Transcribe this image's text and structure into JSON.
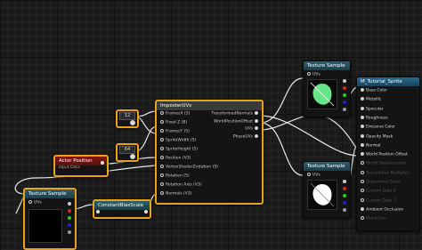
{
  "texture_sample_top": {
    "title": "Texture Sample",
    "uvs": "UVs"
  },
  "texture_sample_mid": {
    "title": "Texture Sample",
    "uvs": "UVs"
  },
  "texture_sample_left": {
    "title": "Texture Sample",
    "uvs": "UVs"
  },
  "material": {
    "title": "M_Tutorial_Sprite",
    "pins": [
      {
        "label": "Base Color",
        "enabled": true
      },
      {
        "label": "Metallic",
        "enabled": true
      },
      {
        "label": "Specular",
        "enabled": true
      },
      {
        "label": "Roughness",
        "enabled": true
      },
      {
        "label": "Emissive Color",
        "enabled": true
      },
      {
        "label": "Opacity Mask",
        "enabled": true
      },
      {
        "label": "Normal",
        "enabled": true
      },
      {
        "label": "World Position Offset",
        "enabled": true
      },
      {
        "label": "World Displacement",
        "enabled": false
      },
      {
        "label": "Tessellation Multiplier",
        "enabled": false
      },
      {
        "label": "Subsurface Color",
        "enabled": false
      },
      {
        "label": "Custom Data 0",
        "enabled": false
      },
      {
        "label": "Custom Data 1",
        "enabled": false
      },
      {
        "label": "Ambient Occlusion",
        "enabled": true
      },
      {
        "label": "Refraction",
        "enabled": false
      }
    ]
  },
  "imposter": {
    "title": "ImposterUVs",
    "inputs": [
      "FramesX (S)",
      "Fixed Z (B)",
      "FramesY (S)",
      "SpriteWidth (S)",
      "SpriteHeight (S)",
      "Position (V3)",
      "VertexShaderZrotation (S)",
      "Rotation (S)",
      "Rotation Axis (V3)",
      "Normals (V3)"
    ],
    "outputs": [
      "TransformedNormals",
      "WorldPositionOffset",
      "UVs",
      "PhaseUVs"
    ]
  },
  "const_12": {
    "value": "12"
  },
  "const_64": {
    "value": "64"
  },
  "actor_position": {
    "title": "Actor Position",
    "subtitle": "Input Data"
  },
  "constant_bias_scale": {
    "title": "ConstantBiasScale"
  }
}
